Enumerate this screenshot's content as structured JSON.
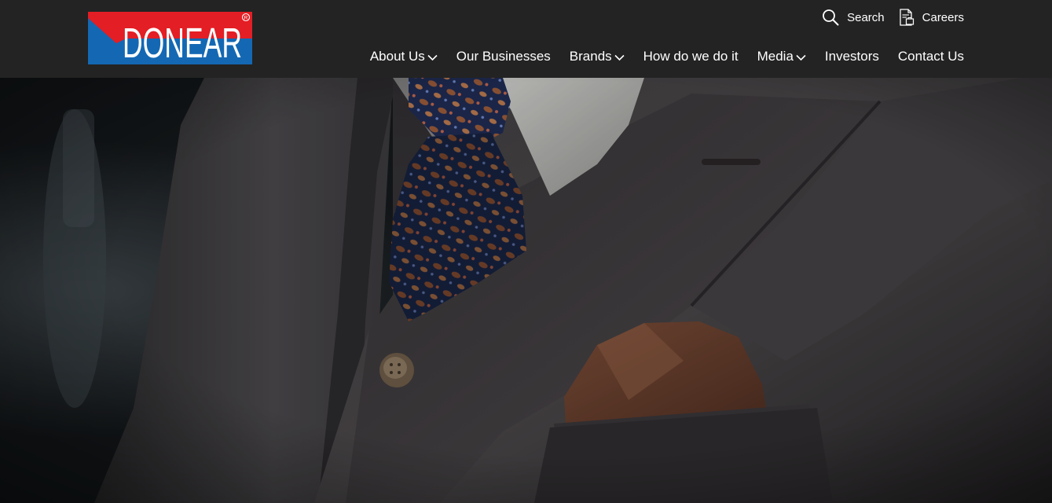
{
  "brand": {
    "name": "DONEAR",
    "registered_mark": "®",
    "colors": {
      "red": "#e31e24",
      "blue": "#1468b3",
      "white": "#ffffff"
    }
  },
  "utility": {
    "search_label": "Search",
    "careers_label": "Careers"
  },
  "nav": {
    "items": [
      {
        "label": "About Us",
        "has_dropdown": true
      },
      {
        "label": "Our Businesses",
        "has_dropdown": false
      },
      {
        "label": "Brands",
        "has_dropdown": true
      },
      {
        "label": "How do we do it",
        "has_dropdown": false
      },
      {
        "label": "Media",
        "has_dropdown": true
      },
      {
        "label": "Investors",
        "has_dropdown": false
      },
      {
        "label": "Contact Us",
        "has_dropdown": false
      }
    ]
  },
  "hero": {
    "image_subject": "suit-jacket-with-paisley-tie-and-pocket-square"
  },
  "theme": {
    "header_bg": "#232323",
    "text": "#ffffff"
  }
}
